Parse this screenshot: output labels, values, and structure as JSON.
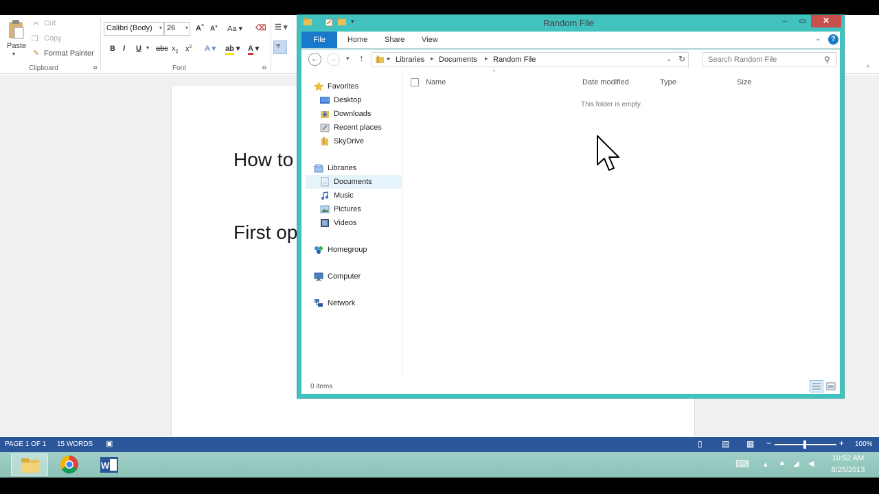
{
  "word": {
    "clipboard": {
      "paste_label": "Paste",
      "cut_label": "Cut",
      "copy_label": "Copy",
      "format_painter_label": "Format Painter",
      "group_label": "Clipboard"
    },
    "font": {
      "font_name": "Calibri (Body)",
      "font_size": "26",
      "group_label": "Font"
    },
    "document": {
      "line1": "How to",
      "line2": "First op"
    },
    "status": {
      "page": "PAGE 1 OF 1",
      "words": "15 WORDS",
      "zoom": "100%"
    }
  },
  "explorer": {
    "title": "Random File",
    "tabs": [
      "File",
      "Home",
      "Share",
      "View"
    ],
    "breadcrumb": [
      "Libraries",
      "Documents",
      "Random File"
    ],
    "search_placeholder": "Search Random File",
    "nav": {
      "favorites": "Favorites",
      "favorites_items": [
        "Desktop",
        "Downloads",
        "Recent places",
        "SkyDrive"
      ],
      "libraries": "Libraries",
      "libraries_items": [
        "Documents",
        "Music",
        "Pictures",
        "Videos"
      ],
      "homegroup": "Homegroup",
      "computer": "Computer",
      "network": "Network",
      "selected": "Documents"
    },
    "columns": [
      "Name",
      "Date modified",
      "Type",
      "Size"
    ],
    "empty_message": "This folder is empty.",
    "items_count": "0 items"
  },
  "taskbar": {
    "time": "10:52 AM",
    "date": "8/25/2013",
    "apps": [
      "File Explorer",
      "Google Chrome",
      "Microsoft Word"
    ]
  },
  "colors": {
    "explorer_frame": "#41c2bf",
    "word_status_bar": "#2b579a",
    "file_tab": "#1979ca",
    "close_button": "#c7504d"
  }
}
